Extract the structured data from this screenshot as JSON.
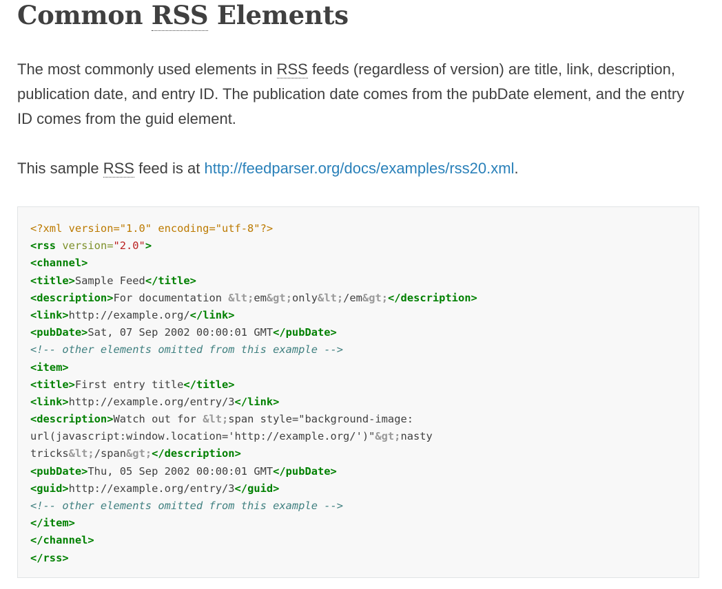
{
  "heading": {
    "before": "Common ",
    "abbr": "RSS",
    "after": " Elements"
  },
  "para1": {
    "t1": "The most commonly used elements in ",
    "abbr": "RSS",
    "t2": " feeds (regardless of version) are title, link, description, publication date, and entry ID. The publication date comes from the pubDate element, and the entry ID comes from the guid element."
  },
  "para2": {
    "t1": "This sample ",
    "abbr": "RSS",
    "t2": " feed is at ",
    "link": "http://feedparser.org/docs/examples/rss20.xml",
    "t3": "."
  },
  "code": {
    "lines": [
      [
        {
          "c": "decl",
          "t": "<?xml version=\"1.0\" encoding=\"utf-8\"?>"
        }
      ],
      [
        {
          "c": "tag",
          "t": "<rss"
        },
        {
          "c": "attr",
          "t": " version="
        },
        {
          "c": "str",
          "t": "\"2.0\""
        },
        {
          "c": "tag",
          "t": ">"
        }
      ],
      [
        {
          "c": "tag",
          "t": "<channel>"
        }
      ],
      [
        {
          "c": "tag",
          "t": "<title>"
        },
        {
          "c": "",
          "t": "Sample Feed"
        },
        {
          "c": "tag",
          "t": "</title>"
        }
      ],
      [
        {
          "c": "tag",
          "t": "<description>"
        },
        {
          "c": "",
          "t": "For documentation "
        },
        {
          "c": "ent",
          "t": "&lt;"
        },
        {
          "c": "",
          "t": "em"
        },
        {
          "c": "ent",
          "t": "&gt;"
        },
        {
          "c": "",
          "t": "only"
        },
        {
          "c": "ent",
          "t": "&lt;"
        },
        {
          "c": "",
          "t": "/em"
        },
        {
          "c": "ent",
          "t": "&gt;"
        },
        {
          "c": "tag",
          "t": "</description>"
        }
      ],
      [
        {
          "c": "tag",
          "t": "<link>"
        },
        {
          "c": "",
          "t": "http://example.org/"
        },
        {
          "c": "tag",
          "t": "</link>"
        }
      ],
      [
        {
          "c": "tag",
          "t": "<pubDate>"
        },
        {
          "c": "",
          "t": "Sat, 07 Sep 2002 00:00:01 GMT"
        },
        {
          "c": "tag",
          "t": "</pubDate>"
        }
      ],
      [
        {
          "c": "cmt",
          "t": "<!-- other elements omitted from this example -->"
        }
      ],
      [
        {
          "c": "tag",
          "t": "<item>"
        }
      ],
      [
        {
          "c": "tag",
          "t": "<title>"
        },
        {
          "c": "",
          "t": "First entry title"
        },
        {
          "c": "tag",
          "t": "</title>"
        }
      ],
      [
        {
          "c": "tag",
          "t": "<link>"
        },
        {
          "c": "",
          "t": "http://example.org/entry/3"
        },
        {
          "c": "tag",
          "t": "</link>"
        }
      ],
      [
        {
          "c": "tag",
          "t": "<description>"
        },
        {
          "c": "",
          "t": "Watch out for "
        },
        {
          "c": "ent",
          "t": "&lt;"
        },
        {
          "c": "",
          "t": "span style=\"background-image:"
        }
      ],
      [
        {
          "c": "",
          "t": "url(javascript:window.location='http://example.org/')\""
        },
        {
          "c": "ent",
          "t": "&gt;"
        },
        {
          "c": "",
          "t": "nasty"
        }
      ],
      [
        {
          "c": "",
          "t": "tricks"
        },
        {
          "c": "ent",
          "t": "&lt;"
        },
        {
          "c": "",
          "t": "/span"
        },
        {
          "c": "ent",
          "t": "&gt;"
        },
        {
          "c": "tag",
          "t": "</description>"
        }
      ],
      [
        {
          "c": "tag",
          "t": "<pubDate>"
        },
        {
          "c": "",
          "t": "Thu, 05 Sep 2002 00:00:01 GMT"
        },
        {
          "c": "tag",
          "t": "</pubDate>"
        }
      ],
      [
        {
          "c": "tag",
          "t": "<guid>"
        },
        {
          "c": "",
          "t": "http://example.org/entry/3"
        },
        {
          "c": "tag",
          "t": "</guid>"
        }
      ],
      [
        {
          "c": "cmt",
          "t": "<!-- other elements omitted from this example -->"
        }
      ],
      [
        {
          "c": "tag",
          "t": "</item>"
        }
      ],
      [
        {
          "c": "tag",
          "t": "</channel>"
        }
      ],
      [
        {
          "c": "tag",
          "t": "</rss>"
        }
      ]
    ]
  }
}
